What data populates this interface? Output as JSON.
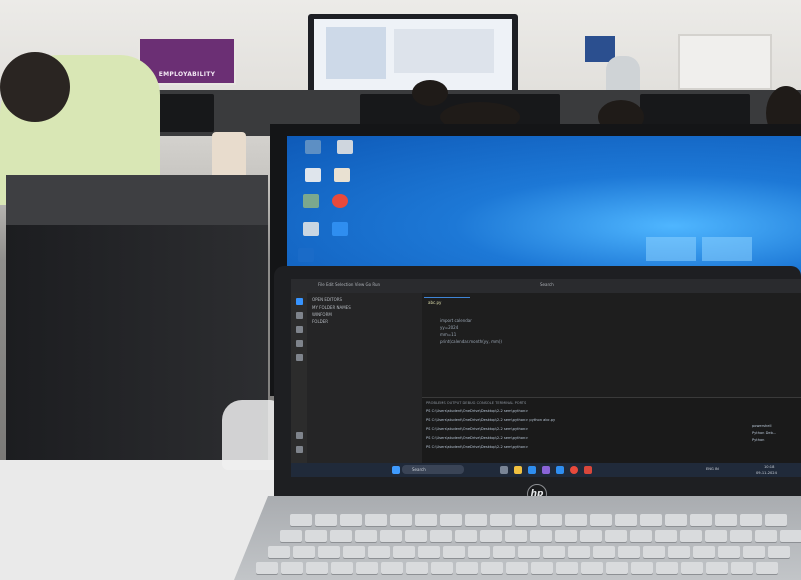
{
  "scene": {
    "description_tags": [
      "classroom",
      "laptop",
      "desktop-monitor"
    ]
  },
  "banner": {
    "text": "EMPLOYABILITY"
  },
  "vscode": {
    "menu": [
      "File",
      "Edit",
      "Selection",
      "View",
      "Go",
      "Run"
    ],
    "search_placeholder": "Search",
    "tab_label": "abc.py",
    "explorer_items": [
      "OPEN EDITORS",
      "MY FOLDER NAMES",
      "WINFORM",
      "FOLDER"
    ],
    "code_lines": [
      "import calendar",
      "yy=2024",
      "mm=11",
      "print(calendar.month(yy, mm))"
    ],
    "terminal_tabs": "PROBLEMS  OUTPUT  DEBUG CONSOLE  TERMINAL  PORTS",
    "terminal_lines": [
      "PS C:\\Users\\student\\OneDrive\\Desktop\\2-2 sem\\python>",
      "PS C:\\Users\\student\\OneDrive\\Desktop\\2-2 sem\\python> python abc.py",
      "PS C:\\Users\\student\\OneDrive\\Desktop\\2-2 sem\\python>",
      "PS C:\\Users\\student\\OneDrive\\Desktop\\2-2 sem\\python>",
      "PS C:\\Users\\student\\OneDrive\\Desktop\\2-2 sem\\python>"
    ],
    "right_panel": [
      "powershell",
      "Python Deb...",
      "Python"
    ]
  },
  "taskbar": {
    "search_label": "Search",
    "tray_lang": "ENG IN",
    "tray_time": "10:18",
    "tray_date": "09-11-2024"
  },
  "laptop": {
    "brand": "hp"
  },
  "colors": {
    "desktop_blue": "#1d78d6",
    "vscode_bg": "#1e1e1e",
    "shirt": "#d9e7b5"
  },
  "icons": [
    "folder-icon",
    "chrome-icon",
    "recycle-bin-icon",
    "vscode-icon",
    "windows-logo-icon"
  ]
}
